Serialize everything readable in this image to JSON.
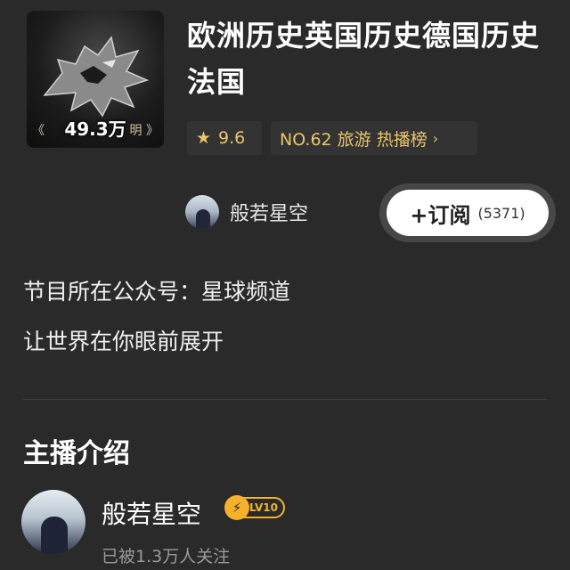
{
  "album": {
    "cover_play_count": "49.3万",
    "cover_deco_left": "《",
    "cover_deco_right": "明 》",
    "title": "欧洲历史英国历史德国历史法国",
    "rating": "9.6",
    "rating_icon": "star-icon",
    "rank_label": "NO.62 旅游 热播榜",
    "rank_chevron": "›"
  },
  "author": {
    "name": "般若星空"
  },
  "subscribe": {
    "label": "+订阅",
    "count": "(5371)"
  },
  "description": {
    "line1": "节目所在公众号：星球频道",
    "line2": "让世界在你眼前展开"
  },
  "host_section": {
    "title": "主播介绍",
    "host_name": "般若星空",
    "level": "LV10",
    "followers": "已被1.3万人关注"
  },
  "colors": {
    "background": "#2a2a2a",
    "accent_gold": "#e9c46a",
    "badge_orange": "#f2b32b"
  }
}
